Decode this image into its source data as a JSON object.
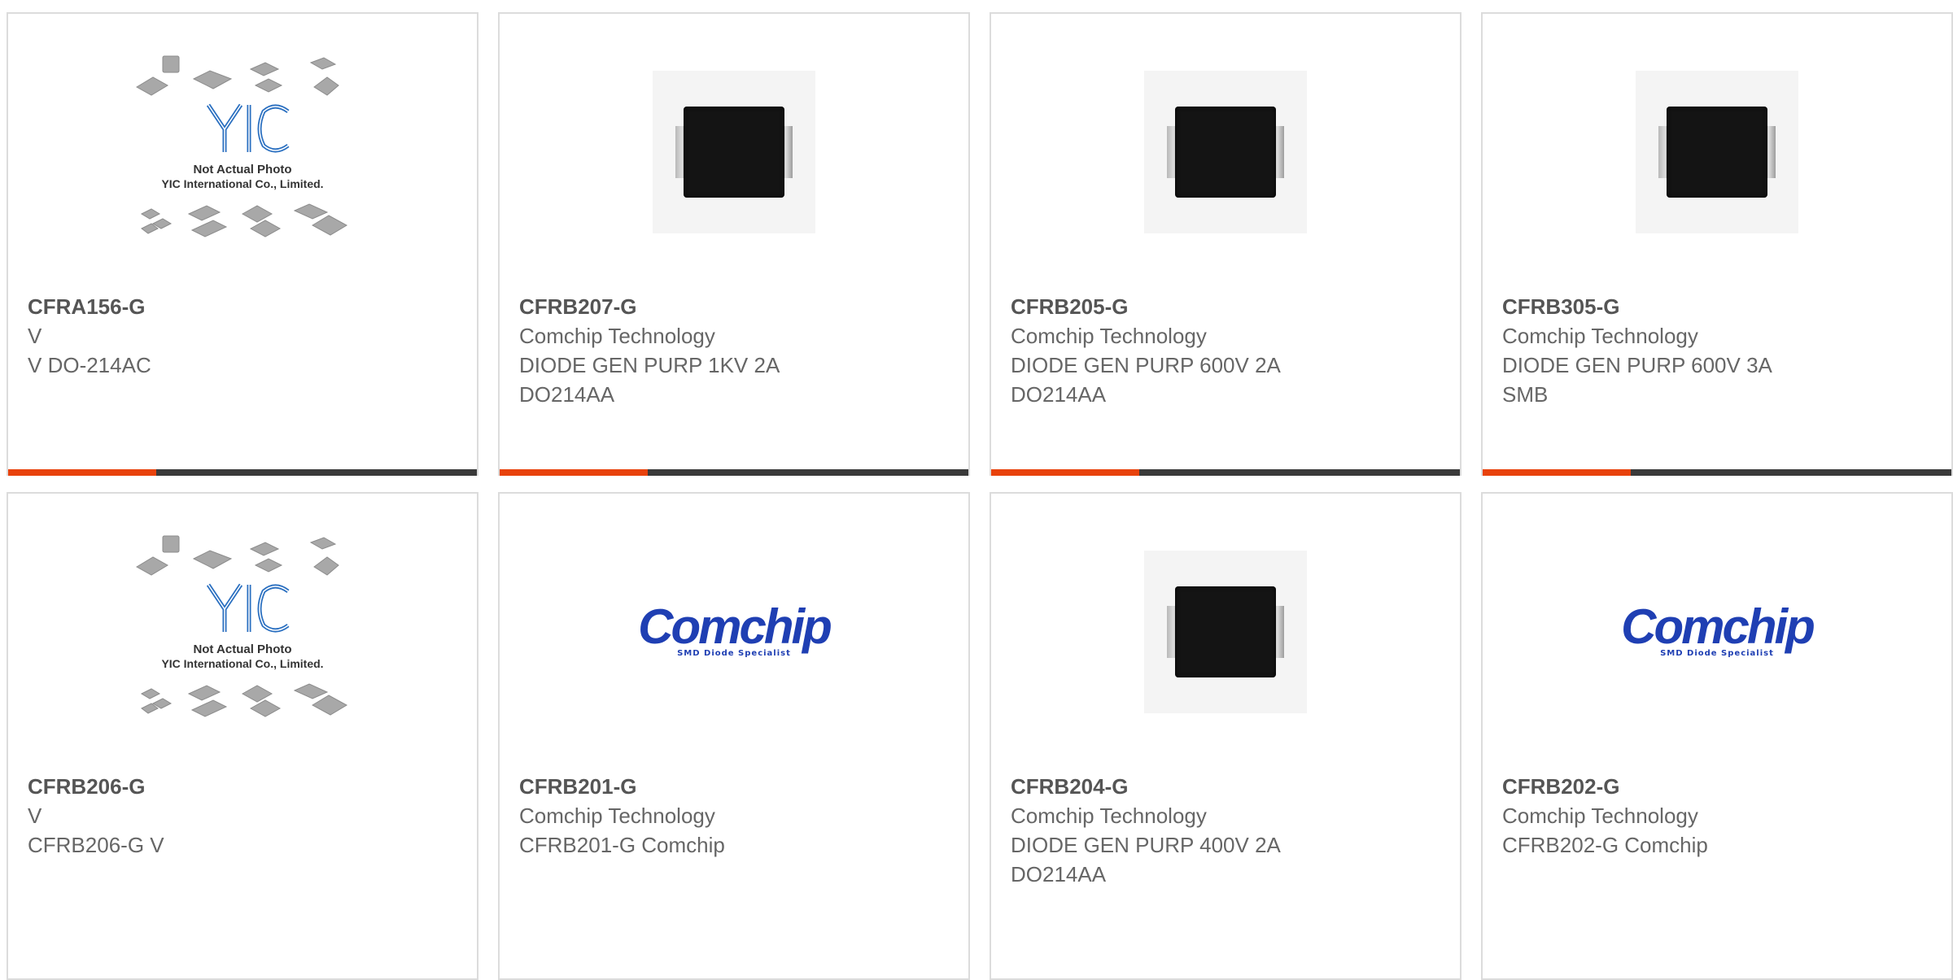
{
  "cards": [
    {
      "part_number": "CFRA156-G",
      "lines": [
        "V",
        "V DO-214AC"
      ],
      "image": "yic-placeholder",
      "placeholder_text": [
        "Not Actual Photo",
        "YIC International Co., Limited."
      ],
      "placeholder_logo": "YIC"
    },
    {
      "part_number": "CFRB207-G",
      "lines": [
        "Comchip Technology",
        "DIODE GEN PURP 1KV 2A",
        "DO214AA"
      ],
      "image": "diode-photo"
    },
    {
      "part_number": "CFRB205-G",
      "lines": [
        "Comchip Technology",
        "DIODE GEN PURP 600V 2A",
        "DO214AA"
      ],
      "image": "diode-photo"
    },
    {
      "part_number": "CFRB305-G",
      "lines": [
        "Comchip Technology",
        "DIODE GEN PURP 600V 3A",
        "SMB"
      ],
      "image": "diode-photo"
    },
    {
      "part_number": "CFRB206-G",
      "lines": [
        "V",
        "CFRB206-G V"
      ],
      "image": "yic-placeholder",
      "placeholder_text": [
        "Not Actual Photo",
        "YIC International Co., Limited."
      ],
      "placeholder_logo": "YIC"
    },
    {
      "part_number": "CFRB201-G",
      "lines": [
        "Comchip Technology",
        "CFRB201-G Comchip"
      ],
      "image": "comchip-logo",
      "logo_word": "Comchip",
      "logo_tag": "SMD Diode Specialist"
    },
    {
      "part_number": "CFRB204-G",
      "lines": [
        "Comchip Technology",
        "DIODE GEN PURP 400V 2A",
        "DO214AA"
      ],
      "image": "diode-photo"
    },
    {
      "part_number": "CFRB202-G",
      "lines": [
        "Comchip Technology",
        "CFRB202-G Comchip"
      ],
      "image": "comchip-logo",
      "logo_word": "Comchip",
      "logo_tag": "SMD Diode Specialist"
    }
  ],
  "colors": {
    "accent": "#e8420c",
    "bar": "#3a3a3a",
    "border": "#dcdcdc",
    "part_number": "#555555",
    "text": "#666666",
    "comchip_blue": "#1f3fb3",
    "yic_blue": "#2a6fc0"
  }
}
